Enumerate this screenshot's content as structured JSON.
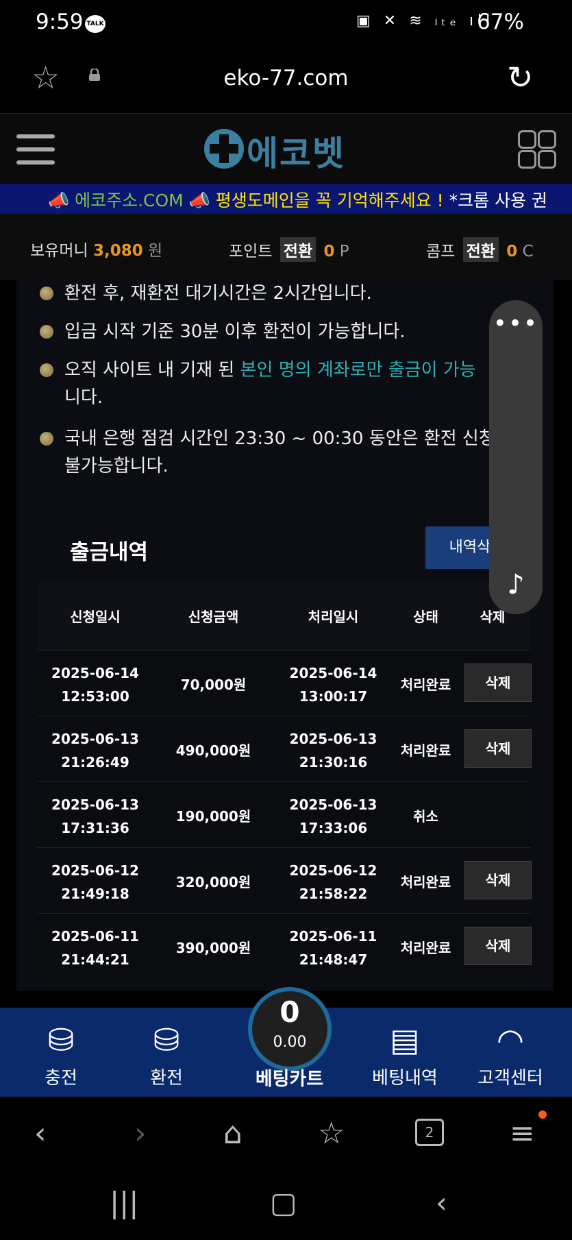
{
  "status_bar": {
    "time": "9:59",
    "talk_badge": "TALK",
    "icons": "▣ ✕ ≋ ₗₜₑ ıll",
    "battery": "67%"
  },
  "browser": {
    "url": "eko-77.com"
  },
  "site": {
    "logo_text": "에코벳"
  },
  "marquee": {
    "part1": "에코주소.COM",
    "part2": "평생도메인을 꼭 기억해주세요 !",
    "part3": "*크롬 사용 권"
  },
  "balance": {
    "money_label": "보유머니",
    "money_value": "3,080",
    "money_unit": "원",
    "point_label": "포인트",
    "point_convert": "전환",
    "point_value": "0",
    "point_unit": "P",
    "comp_label": "콤프",
    "comp_convert": "전환",
    "comp_value": "0",
    "comp_unit": "C"
  },
  "notices": {
    "n1": "환전 후, 재환전 대기시간은 2시간입니다.",
    "n2": "입금 시작 기준 30분 이후 환전이 가능합니다.",
    "n3_pre": "오직 사이트 내 기재 된 ",
    "n3_hl": "본인 명의 계좌로만 출금이 가능",
    "n3_line2": "니다.",
    "n4_line1": "국내 은행 점검 시간인 23:30 ~ 00:30 동안은 환전 신청",
    "n4_line2": "불가능합니다."
  },
  "withdrawal": {
    "title": "출금내역",
    "delete_all": "내역삭",
    "headers": [
      "신청일시",
      "신청금액",
      "처리일시",
      "상태",
      "삭제"
    ],
    "rows": [
      {
        "req_date": "2025-06-14",
        "req_time": "12:53:00",
        "amount": "70,000원",
        "proc_date": "2025-06-14",
        "proc_time": "13:00:17",
        "status": "처리완료",
        "delete": "삭제"
      },
      {
        "req_date": "2025-06-13",
        "req_time": "21:26:49",
        "amount": "490,000원",
        "proc_date": "2025-06-13",
        "proc_time": "21:30:16",
        "status": "처리완료",
        "delete": "삭제"
      },
      {
        "req_date": "2025-06-13",
        "req_time": "17:31:36",
        "amount": "190,000원",
        "proc_date": "2025-06-13",
        "proc_time": "17:33:06",
        "status": "취소",
        "delete": ""
      },
      {
        "req_date": "2025-06-12",
        "req_time": "21:49:18",
        "amount": "320,000원",
        "proc_date": "2025-06-12",
        "proc_time": "21:58:22",
        "status": "처리완료",
        "delete": "삭제"
      },
      {
        "req_date": "2025-06-11",
        "req_time": "21:44:21",
        "amount": "390,000원",
        "proc_date": "2025-06-11",
        "proc_time": "21:48:47",
        "status": "처리완료",
        "delete": "삭제"
      }
    ]
  },
  "bottom_nav": {
    "deposit": "충전",
    "withdraw": "환전",
    "cart_label": "베팅카트",
    "cart_count": "0",
    "cart_amount": "0.00",
    "bet_history": "베팅내역",
    "support": "고객센터"
  },
  "browser_nav": {
    "tabs_count": "2"
  }
}
